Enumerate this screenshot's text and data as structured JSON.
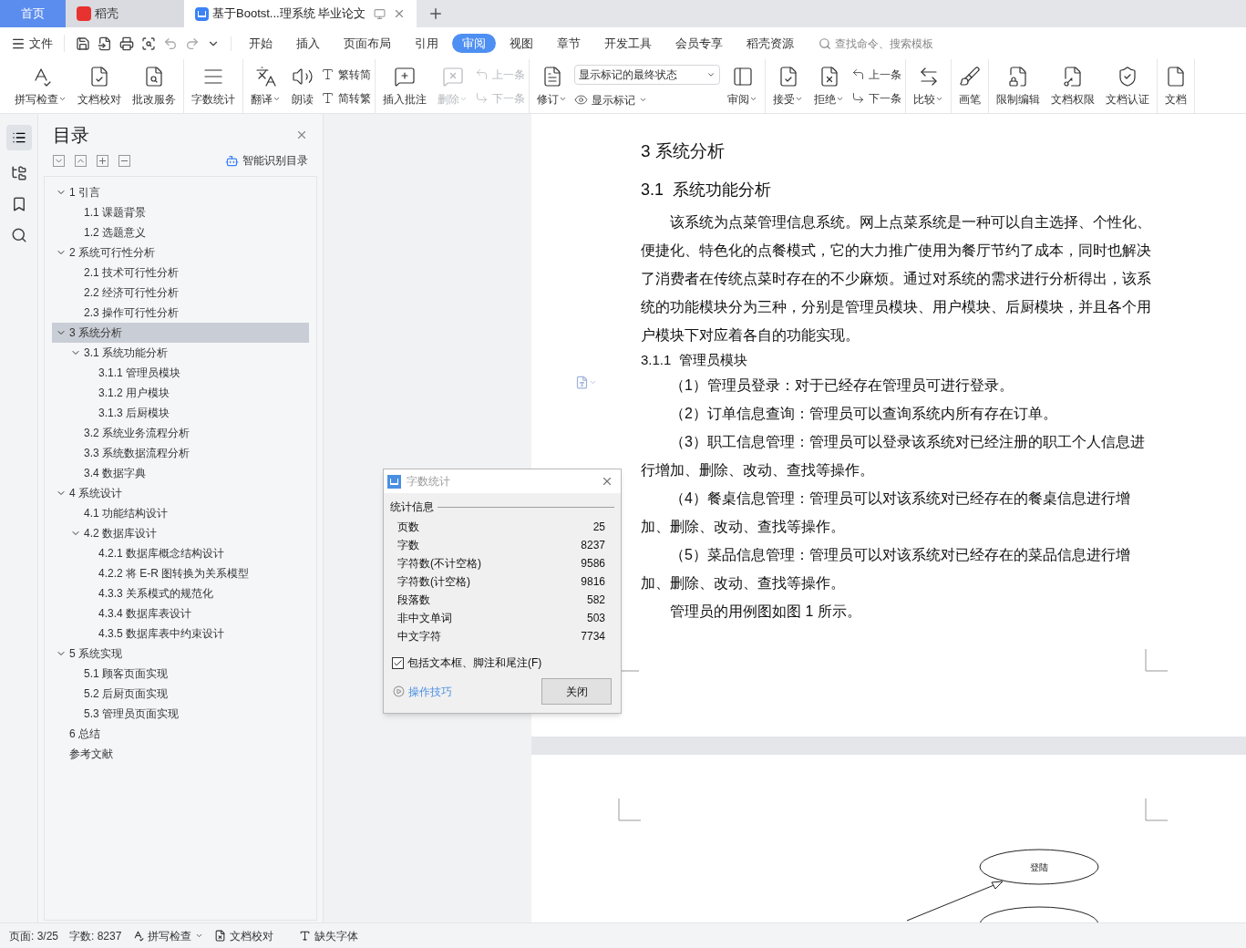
{
  "tabs": [
    {
      "label": "首页",
      "kind": "home",
      "selected": false
    },
    {
      "label": "稻壳",
      "kind": "app",
      "selected": false
    },
    {
      "label": "基于Bootst...理系统 毕业论文",
      "kind": "doc",
      "selected": true
    }
  ],
  "menu": {
    "file": "文件",
    "tabs": [
      {
        "label": "开始",
        "selected": false
      },
      {
        "label": "插入",
        "selected": false
      },
      {
        "label": "页面布局",
        "selected": false
      },
      {
        "label": "引用",
        "selected": false
      },
      {
        "label": "审阅",
        "selected": true
      },
      {
        "label": "视图",
        "selected": false
      },
      {
        "label": "章节",
        "selected": false
      },
      {
        "label": "开发工具",
        "selected": false
      },
      {
        "label": "会员专享",
        "selected": false
      },
      {
        "label": "稻壳资源",
        "selected": false
      }
    ],
    "search": {
      "placeholder": "查找命令、搜索模板"
    }
  },
  "ribbon": [
    [
      {
        "kind": "big",
        "label": "拼写检查",
        "caret": true,
        "disabled": false
      },
      {
        "kind": "big",
        "label": "文档校对",
        "caret": false,
        "disabled": false
      },
      {
        "kind": "big",
        "label": "批改服务",
        "caret": false,
        "disabled": false
      }
    ],
    [
      {
        "kind": "big",
        "label": "字数统计",
        "caret": false,
        "disabled": false
      }
    ],
    [
      {
        "kind": "big",
        "label": "翻译",
        "caret": true,
        "disabled": false
      },
      {
        "kind": "big",
        "label": "朗读",
        "caret": false,
        "disabled": false
      },
      {
        "kind": "stack",
        "items": [
          {
            "label": "繁转简",
            "disabled": false
          },
          {
            "label": "简转繁",
            "disabled": false
          }
        ]
      }
    ],
    [
      {
        "kind": "big",
        "label": "插入批注",
        "caret": false,
        "disabled": false
      },
      {
        "kind": "big",
        "label": "删除",
        "caret": true,
        "disabled": true
      },
      {
        "kind": "stack",
        "items": [
          {
            "label": "上一条",
            "disabled": true
          },
          {
            "label": "下一条",
            "disabled": true
          }
        ]
      }
    ],
    [
      {
        "kind": "big",
        "label": "修订",
        "caret": true,
        "disabled": false
      },
      {
        "kind": "select",
        "value": "显示标记的最终状态",
        "label": "显示标记"
      },
      {
        "kind": "big",
        "label": "审阅",
        "caret": true,
        "disabled": false
      }
    ],
    [
      {
        "kind": "big",
        "label": "接受",
        "caret": true,
        "disabled": false
      },
      {
        "kind": "big",
        "label": "拒绝",
        "caret": true,
        "disabled": false
      },
      {
        "kind": "stack",
        "items": [
          {
            "label": "上一条",
            "disabled": false
          },
          {
            "label": "下一条",
            "disabled": false
          }
        ]
      }
    ],
    [
      {
        "kind": "big",
        "label": "比较",
        "caret": true,
        "disabled": false
      }
    ],
    [
      {
        "kind": "big",
        "label": "画笔",
        "caret": false,
        "disabled": false
      }
    ],
    [
      {
        "kind": "big",
        "label": "限制编辑",
        "caret": false,
        "disabled": false
      },
      {
        "kind": "big",
        "label": "文档权限",
        "caret": false,
        "disabled": false
      },
      {
        "kind": "big",
        "label": "文档认证",
        "caret": false,
        "disabled": false
      }
    ],
    [
      {
        "kind": "big",
        "label": "文档",
        "caret": false,
        "disabled": false
      }
    ]
  ],
  "toc": {
    "title": "目录",
    "smart": "智能识别目录",
    "items": [
      {
        "label": "1 引言",
        "selected": false,
        "expanded": true,
        "children": [
          {
            "label": "1.1 课题背景",
            "selected": false
          },
          {
            "label": "1.2 选题意义",
            "selected": false
          }
        ]
      },
      {
        "label": "2 系统可行性分析",
        "selected": false,
        "expanded": true,
        "children": [
          {
            "label": "2.1 技术可行性分析",
            "selected": false
          },
          {
            "label": "2.2 经济可行性分析",
            "selected": false
          },
          {
            "label": "2.3 操作可行性分析",
            "selected": false
          }
        ]
      },
      {
        "label": "3 系统分析",
        "selected": true,
        "expanded": true,
        "children": [
          {
            "label": "3.1 系统功能分析",
            "selected": false,
            "expanded": true,
            "children": [
              {
                "label": "3.1.1 管理员模块",
                "selected": false
              },
              {
                "label": "3.1.2 用户模块",
                "selected": false
              },
              {
                "label": "3.1.3 后厨模块",
                "selected": false
              }
            ]
          },
          {
            "label": "3.2 系统业务流程分析",
            "selected": false
          },
          {
            "label": "3.3 系统数据流程分析",
            "selected": false
          },
          {
            "label": "3.4 数据字典",
            "selected": false
          }
        ]
      },
      {
        "label": "4 系统设计",
        "selected": false,
        "expanded": true,
        "children": [
          {
            "label": "4.1 功能结构设计",
            "selected": false
          },
          {
            "label": "4.2 数据库设计",
            "selected": false,
            "expanded": true,
            "children": [
              {
                "label": "4.2.1 数据库概念结构设计",
                "selected": false
              },
              {
                "label": "4.2.2 将 E-R 图转换为关系模型",
                "selected": false
              },
              {
                "label": "4.3.3 关系模式的规范化",
                "selected": false
              },
              {
                "label": "4.3.4 数据库表设计",
                "selected": false
              },
              {
                "label": "4.3.5 数据库表中约束设计",
                "selected": false
              }
            ]
          }
        ]
      },
      {
        "label": "5 系统实现",
        "selected": false,
        "expanded": true,
        "children": [
          {
            "label": "5.1 顾客页面实现",
            "selected": false
          },
          {
            "label": "5.2 后厨页面实现",
            "selected": false
          },
          {
            "label": "5.3 管理员页面实现",
            "selected": false
          }
        ]
      },
      {
        "label": "6 总结",
        "selected": false
      },
      {
        "label": "参考文献",
        "selected": false
      }
    ]
  },
  "document": {
    "blocks": [
      {
        "kind": "h1",
        "text": "3 系统分析"
      },
      {
        "kind": "h2",
        "text": "3.1  系统功能分析"
      },
      {
        "kind": "p",
        "text": "该系统为点菜管理信息系统。网上点菜系统是一种可以自主选择、个性化、便捷化、特色化的点餐模式，它的大力推广使用为餐厅节约了成本，同时也解决了消费者在传统点菜时存在的不少麻烦。通过对系统的需求进行分析得出，该系统的功能模块分为三种，分别是管理员模块、用户模块、后厨模块，并且各个用户模块下对应着各自的功能实现。"
      },
      {
        "kind": "h3",
        "text": "3.1.1  管理员模块"
      },
      {
        "kind": "p",
        "text": "（1）管理员登录：对于已经存在管理员可进行登录。"
      },
      {
        "kind": "p",
        "text": "（2）订单信息查询：管理员可以查询系统内所有存在订单。"
      },
      {
        "kind": "p",
        "text": "（3）职工信息管理：管理员可以登录该系统对已经注册的职工个人信息进行增加、删除、改动、查找等操作。"
      },
      {
        "kind": "p",
        "text": "（4）餐桌信息管理：管理员可以对该系统对已经存在的餐桌信息进行增加、删除、改动、查找等操作。"
      },
      {
        "kind": "p",
        "text": "（5）菜品信息管理：管理员可以对该系统对已经存在的菜品信息进行增加、删除、改动、查找等操作。"
      },
      {
        "kind": "p",
        "text": "管理员的用例图如图 1 所示。"
      }
    ],
    "diagram": {
      "node": "登陆"
    }
  },
  "dialog": {
    "title": "字数统计",
    "section": "统计信息",
    "rows": [
      {
        "label": "页数",
        "value": "25"
      },
      {
        "label": "字数",
        "value": "8237"
      },
      {
        "label": "字符数(不计空格)",
        "value": "9586"
      },
      {
        "label": "字符数(计空格)",
        "value": "9816"
      },
      {
        "label": "段落数",
        "value": "582"
      },
      {
        "label": "非中文单词",
        "value": "503"
      },
      {
        "label": "中文字符",
        "value": "7734"
      }
    ],
    "checkbox": {
      "label": "包括文本框、脚注和尾注(F)",
      "checked": true
    },
    "tips": "操作技巧",
    "close": "关闭"
  },
  "status_bar": {
    "page": "页面: 3/25",
    "words": "字数: 8237",
    "spell": "拼写检查",
    "proof": "文档校对",
    "font": "缺失字体"
  }
}
